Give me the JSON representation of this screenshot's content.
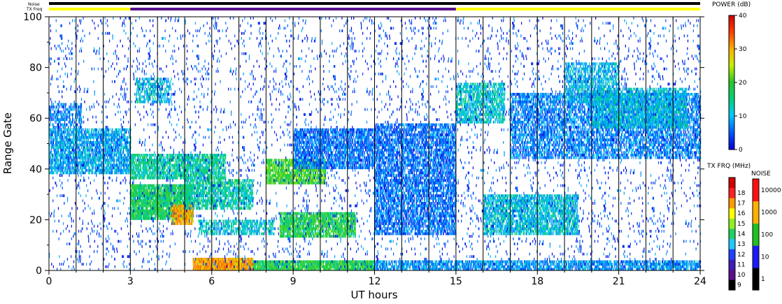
{
  "chart_data": {
    "type": "heatmap",
    "xlabel": "UT hours",
    "ylabel": "Range Gate",
    "xlim": [
      0,
      24
    ],
    "ylim": [
      0,
      100
    ],
    "x_ticks": [
      "0",
      "3",
      "6",
      "9",
      "12",
      "15",
      "18",
      "21",
      "24"
    ],
    "y_ticks": [
      "0",
      "20",
      "40",
      "60",
      "80",
      "100"
    ],
    "vertical_scan_lines_ut": [
      1,
      2,
      3,
      4,
      5,
      6,
      7,
      8,
      9,
      10,
      11,
      12,
      13,
      14,
      15,
      16,
      17,
      18,
      19,
      20,
      21,
      22,
      23
    ],
    "top_bars": {
      "noise_label": "Noise",
      "txfreq_label": "TX Freq",
      "noise_color": "#000000",
      "txfreq_segments": [
        {
          "start": 0,
          "end": 3,
          "mhz": 15,
          "color": "#ffff00"
        },
        {
          "start": 3,
          "end": 15,
          "mhz": 10,
          "color": "#5a0f8c"
        },
        {
          "start": 15,
          "end": 24,
          "mhz": 15,
          "color": "#ffff00"
        }
      ]
    },
    "power_colorbar": {
      "title": "POWER (dB)",
      "ticks": [
        "0",
        "10",
        "20",
        "30",
        "40"
      ],
      "range": [
        0,
        40
      ]
    },
    "txfreq_colorbar": {
      "title": "TX FRQ (MHz)",
      "labels": [
        "9",
        "10",
        "11",
        "12",
        "13",
        "14",
        "15",
        "16",
        "17",
        "18"
      ],
      "colors": [
        "#000000",
        "#5a0f8c",
        "#3c1eb4",
        "#2040ff",
        "#20c8ff",
        "#20d060",
        "#90f020",
        "#ffff00",
        "#ff9a00",
        "#ff2020",
        "#d00000"
      ]
    },
    "noise_colorbar": {
      "title": "NOISE",
      "labels": [
        "1",
        "10",
        "100",
        "1000",
        "10000"
      ],
      "colors": [
        "#000000",
        "#1a1aff",
        "#20c020",
        "#ffb000",
        "#ff1010"
      ]
    },
    "echo_regions": [
      {
        "t0": 0.0,
        "t1": 3.0,
        "g0": 38,
        "g1": 56,
        "power": 9,
        "density": 0.55
      },
      {
        "t0": 0.0,
        "t1": 1.2,
        "g0": 56,
        "g1": 66,
        "power": 7,
        "density": 0.35
      },
      {
        "t0": 3.0,
        "t1": 5.3,
        "g0": 20,
        "g1": 34,
        "power": 17,
        "density": 0.75
      },
      {
        "t0": 4.5,
        "t1": 5.3,
        "g0": 18,
        "g1": 26,
        "power": 30,
        "density": 0.7
      },
      {
        "t0": 3.0,
        "t1": 6.5,
        "g0": 36,
        "g1": 46,
        "power": 14,
        "density": 0.6
      },
      {
        "t0": 3.2,
        "t1": 4.5,
        "g0": 66,
        "g1": 76,
        "power": 11,
        "density": 0.4
      },
      {
        "t0": 5.0,
        "t1": 7.5,
        "g0": 24,
        "g1": 36,
        "power": 14,
        "density": 0.5
      },
      {
        "t0": 5.3,
        "t1": 7.5,
        "g0": 0,
        "g1": 5,
        "power": 30,
        "density": 0.85
      },
      {
        "t0": 7.5,
        "t1": 12.0,
        "g0": 0,
        "g1": 4,
        "power": 18,
        "density": 0.75
      },
      {
        "t0": 12.0,
        "t1": 24.0,
        "g0": 0,
        "g1": 4,
        "power": 8,
        "density": 0.55
      },
      {
        "t0": 8.0,
        "t1": 10.2,
        "g0": 34,
        "g1": 44,
        "power": 20,
        "density": 0.65
      },
      {
        "t0": 8.5,
        "t1": 11.3,
        "g0": 13,
        "g1": 23,
        "power": 18,
        "density": 0.65
      },
      {
        "t0": 5.5,
        "t1": 8.3,
        "g0": 14,
        "g1": 20,
        "power": 12,
        "density": 0.45
      },
      {
        "t0": 9.0,
        "t1": 12.0,
        "g0": 40,
        "g1": 56,
        "power": 6,
        "density": 0.55
      },
      {
        "t0": 12.0,
        "t1": 15.0,
        "g0": 14,
        "g1": 58,
        "power": 6,
        "density": 0.5
      },
      {
        "t0": 15.0,
        "t1": 16.8,
        "g0": 58,
        "g1": 74,
        "power": 12,
        "density": 0.5
      },
      {
        "t0": 16.0,
        "t1": 19.5,
        "g0": 14,
        "g1": 30,
        "power": 11,
        "density": 0.55
      },
      {
        "t0": 17.0,
        "t1": 24.0,
        "g0": 44,
        "g1": 70,
        "power": 7,
        "density": 0.45
      },
      {
        "t0": 19.0,
        "t1": 21.0,
        "g0": 66,
        "g1": 82,
        "power": 10,
        "density": 0.45
      },
      {
        "t0": 20.0,
        "t1": 23.5,
        "g0": 56,
        "g1": 72,
        "power": 11,
        "density": 0.45
      },
      {
        "t0": 0.0,
        "t1": 24.0,
        "g0": 0,
        "g1": 100,
        "power": 4,
        "density": 0.035
      }
    ]
  }
}
